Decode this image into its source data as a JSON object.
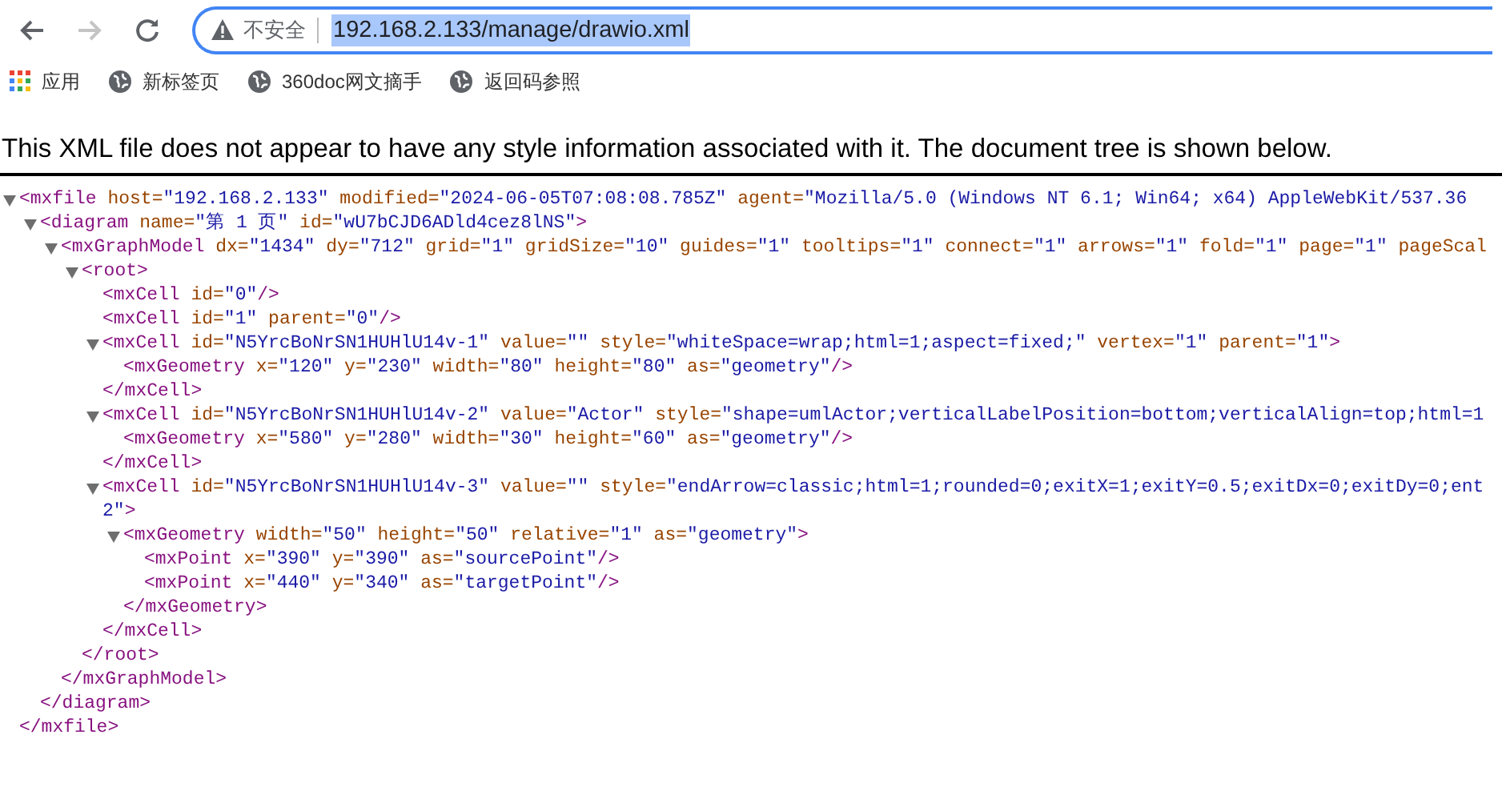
{
  "toolbar": {
    "back_disabled": false,
    "forward_disabled": true,
    "security_label": "不安全",
    "url": {
      "text": "192.168.2.133/manage/drawio.xml",
      "selected": true
    }
  },
  "bookmarks": [
    {
      "kind": "apps",
      "label": "应用"
    },
    {
      "kind": "page",
      "label": "新标签页"
    },
    {
      "kind": "page",
      "label": "360doc网文摘手"
    },
    {
      "kind": "page",
      "label": "返回码参照"
    }
  ],
  "notice": "This XML file does not appear to have any style information associated with it. The document tree is shown below.",
  "tree": [
    {
      "expanded": true,
      "line": [
        {
          "kind": "tag",
          "text": "<mxfile"
        },
        {
          "kind": "attr",
          "text": " host="
        },
        {
          "kind": "value",
          "text": "\"192.168.2.133\""
        },
        {
          "kind": "attr",
          "text": " modified="
        },
        {
          "kind": "value",
          "text": "\"2024-06-05T07:08:08.785Z\""
        },
        {
          "kind": "attr",
          "text": " agent="
        },
        {
          "kind": "value",
          "text": "\"Mozilla/5.0 (Windows NT 6.1; Win64; x64) AppleWebKit/537.36"
        }
      ],
      "children": [
        {
          "expanded": true,
          "line": [
            {
              "kind": "tag",
              "text": "<diagram"
            },
            {
              "kind": "attr",
              "text": " name="
            },
            {
              "kind": "value",
              "text": "\"第 1 页\""
            },
            {
              "kind": "attr",
              "text": " id="
            },
            {
              "kind": "value",
              "text": "\"wU7bCJD6ADld4cez8lNS\""
            },
            {
              "kind": "tag",
              "text": ">"
            }
          ],
          "children": [
            {
              "expanded": true,
              "line": [
                {
                  "kind": "tag",
                  "text": "<mxGraphModel"
                },
                {
                  "kind": "attr",
                  "text": " dx="
                },
                {
                  "kind": "value",
                  "text": "\"1434\""
                },
                {
                  "kind": "attr",
                  "text": " dy="
                },
                {
                  "kind": "value",
                  "text": "\"712\""
                },
                {
                  "kind": "attr",
                  "text": " grid="
                },
                {
                  "kind": "value",
                  "text": "\"1\""
                },
                {
                  "kind": "attr",
                  "text": " gridSize="
                },
                {
                  "kind": "value",
                  "text": "\"10\""
                },
                {
                  "kind": "attr",
                  "text": " guides="
                },
                {
                  "kind": "value",
                  "text": "\"1\""
                },
                {
                  "kind": "attr",
                  "text": " tooltips="
                },
                {
                  "kind": "value",
                  "text": "\"1\""
                },
                {
                  "kind": "attr",
                  "text": " connect="
                },
                {
                  "kind": "value",
                  "text": "\"1\""
                },
                {
                  "kind": "attr",
                  "text": " arrows="
                },
                {
                  "kind": "value",
                  "text": "\"1\""
                },
                {
                  "kind": "attr",
                  "text": " fold="
                },
                {
                  "kind": "value",
                  "text": "\"1\""
                },
                {
                  "kind": "attr",
                  "text": " page="
                },
                {
                  "kind": "value",
                  "text": "\"1\""
                },
                {
                  "kind": "attr",
                  "text": " pageScal"
                }
              ],
              "children": [
                {
                  "expanded": true,
                  "line": [
                    {
                      "kind": "tag",
                      "text": "<root>"
                    }
                  ],
                  "children": [
                    {
                      "line": [
                        {
                          "kind": "tag",
                          "text": "<mxCell"
                        },
                        {
                          "kind": "attr",
                          "text": " id="
                        },
                        {
                          "kind": "value",
                          "text": "\"0\""
                        },
                        {
                          "kind": "tag",
                          "text": "/>"
                        }
                      ]
                    },
                    {
                      "line": [
                        {
                          "kind": "tag",
                          "text": "<mxCell"
                        },
                        {
                          "kind": "attr",
                          "text": " id="
                        },
                        {
                          "kind": "value",
                          "text": "\"1\""
                        },
                        {
                          "kind": "attr",
                          "text": " parent="
                        },
                        {
                          "kind": "value",
                          "text": "\"0\""
                        },
                        {
                          "kind": "tag",
                          "text": "/>"
                        }
                      ]
                    },
                    {
                      "expanded": true,
                      "line": [
                        {
                          "kind": "tag",
                          "text": "<mxCell"
                        },
                        {
                          "kind": "attr",
                          "text": " id="
                        },
                        {
                          "kind": "value",
                          "text": "\"N5YrcBoNrSN1HUHlU14v-1\""
                        },
                        {
                          "kind": "attr",
                          "text": " value="
                        },
                        {
                          "kind": "value",
                          "text": "\"\""
                        },
                        {
                          "kind": "attr",
                          "text": " style="
                        },
                        {
                          "kind": "value",
                          "text": "\"whiteSpace=wrap;html=1;aspect=fixed;\""
                        },
                        {
                          "kind": "attr",
                          "text": " vertex="
                        },
                        {
                          "kind": "value",
                          "text": "\"1\""
                        },
                        {
                          "kind": "attr",
                          "text": " parent="
                        },
                        {
                          "kind": "value",
                          "text": "\"1\""
                        },
                        {
                          "kind": "tag",
                          "text": ">"
                        }
                      ],
                      "children": [
                        {
                          "line": [
                            {
                              "kind": "tag",
                              "text": "<mxGeometry"
                            },
                            {
                              "kind": "attr",
                              "text": " x="
                            },
                            {
                              "kind": "value",
                              "text": "\"120\""
                            },
                            {
                              "kind": "attr",
                              "text": " y="
                            },
                            {
                              "kind": "value",
                              "text": "\"230\""
                            },
                            {
                              "kind": "attr",
                              "text": " width="
                            },
                            {
                              "kind": "value",
                              "text": "\"80\""
                            },
                            {
                              "kind": "attr",
                              "text": " height="
                            },
                            {
                              "kind": "value",
                              "text": "\"80\""
                            },
                            {
                              "kind": "attr",
                              "text": " as="
                            },
                            {
                              "kind": "value",
                              "text": "\"geometry\""
                            },
                            {
                              "kind": "tag",
                              "text": "/>"
                            }
                          ]
                        }
                      ],
                      "end": [
                        {
                          "kind": "tag",
                          "text": "</mxCell>"
                        }
                      ]
                    },
                    {
                      "expanded": true,
                      "line": [
                        {
                          "kind": "tag",
                          "text": "<mxCell"
                        },
                        {
                          "kind": "attr",
                          "text": " id="
                        },
                        {
                          "kind": "value",
                          "text": "\"N5YrcBoNrSN1HUHlU14v-2\""
                        },
                        {
                          "kind": "attr",
                          "text": " value="
                        },
                        {
                          "kind": "value",
                          "text": "\"Actor\""
                        },
                        {
                          "kind": "attr",
                          "text": " style="
                        },
                        {
                          "kind": "value",
                          "text": "\"shape=umlActor;verticalLabelPosition=bottom;verticalAlign=top;html=1"
                        }
                      ],
                      "children": [
                        {
                          "line": [
                            {
                              "kind": "tag",
                              "text": "<mxGeometry"
                            },
                            {
                              "kind": "attr",
                              "text": " x="
                            },
                            {
                              "kind": "value",
                              "text": "\"580\""
                            },
                            {
                              "kind": "attr",
                              "text": " y="
                            },
                            {
                              "kind": "value",
                              "text": "\"280\""
                            },
                            {
                              "kind": "attr",
                              "text": " width="
                            },
                            {
                              "kind": "value",
                              "text": "\"30\""
                            },
                            {
                              "kind": "attr",
                              "text": " height="
                            },
                            {
                              "kind": "value",
                              "text": "\"60\""
                            },
                            {
                              "kind": "attr",
                              "text": " as="
                            },
                            {
                              "kind": "value",
                              "text": "\"geometry\""
                            },
                            {
                              "kind": "tag",
                              "text": "/>"
                            }
                          ]
                        }
                      ],
                      "end": [
                        {
                          "kind": "tag",
                          "text": "</mxCell>"
                        }
                      ]
                    },
                    {
                      "expanded": true,
                      "line": [
                        {
                          "kind": "tag",
                          "text": "<mxCell"
                        },
                        {
                          "kind": "attr",
                          "text": " id="
                        },
                        {
                          "kind": "value",
                          "text": "\"N5YrcBoNrSN1HUHlU14v-3\""
                        },
                        {
                          "kind": "attr",
                          "text": " value="
                        },
                        {
                          "kind": "value",
                          "text": "\"\""
                        },
                        {
                          "kind": "attr",
                          "text": " style="
                        },
                        {
                          "kind": "value",
                          "text": "\"endArrow=classic;html=1;rounded=0;exitX=1;exitY=0.5;exitDx=0;exitDy=0;ent"
                        }
                      ],
                      "line_continued": [
                        {
                          "kind": "value",
                          "text": "2\""
                        },
                        {
                          "kind": "tag",
                          "text": ">"
                        }
                      ],
                      "children": [
                        {
                          "expanded": true,
                          "line": [
                            {
                              "kind": "tag",
                              "text": "<mxGeometry"
                            },
                            {
                              "kind": "attr",
                              "text": " width="
                            },
                            {
                              "kind": "value",
                              "text": "\"50\""
                            },
                            {
                              "kind": "attr",
                              "text": " height="
                            },
                            {
                              "kind": "value",
                              "text": "\"50\""
                            },
                            {
                              "kind": "attr",
                              "text": " relative="
                            },
                            {
                              "kind": "value",
                              "text": "\"1\""
                            },
                            {
                              "kind": "attr",
                              "text": " as="
                            },
                            {
                              "kind": "value",
                              "text": "\"geometry\""
                            },
                            {
                              "kind": "tag",
                              "text": ">"
                            }
                          ],
                          "children": [
                            {
                              "line": [
                                {
                                  "kind": "tag",
                                  "text": "<mxPoint"
                                },
                                {
                                  "kind": "attr",
                                  "text": " x="
                                },
                                {
                                  "kind": "value",
                                  "text": "\"390\""
                                },
                                {
                                  "kind": "attr",
                                  "text": " y="
                                },
                                {
                                  "kind": "value",
                                  "text": "\"390\""
                                },
                                {
                                  "kind": "attr",
                                  "text": " as="
                                },
                                {
                                  "kind": "value",
                                  "text": "\"sourcePoint\""
                                },
                                {
                                  "kind": "tag",
                                  "text": "/>"
                                }
                              ]
                            },
                            {
                              "line": [
                                {
                                  "kind": "tag",
                                  "text": "<mxPoint"
                                },
                                {
                                  "kind": "attr",
                                  "text": " x="
                                },
                                {
                                  "kind": "value",
                                  "text": "\"440\""
                                },
                                {
                                  "kind": "attr",
                                  "text": " y="
                                },
                                {
                                  "kind": "value",
                                  "text": "\"340\""
                                },
                                {
                                  "kind": "attr",
                                  "text": " as="
                                },
                                {
                                  "kind": "value",
                                  "text": "\"targetPoint\""
                                },
                                {
                                  "kind": "tag",
                                  "text": "/>"
                                }
                              ]
                            }
                          ],
                          "end": [
                            {
                              "kind": "tag",
                              "text": "</mxGeometry>"
                            }
                          ]
                        }
                      ],
                      "end": [
                        {
                          "kind": "tag",
                          "text": "</mxCell>"
                        }
                      ]
                    }
                  ],
                  "end": [
                    {
                      "kind": "tag",
                      "text": "</root>"
                    }
                  ]
                }
              ],
              "end": [
                {
                  "kind": "tag",
                  "text": "</mxGraphModel>"
                }
              ]
            }
          ],
          "end": [
            {
              "kind": "tag",
              "text": "</diagram>"
            }
          ]
        }
      ],
      "end": [
        {
          "kind": "tag",
          "text": "</mxfile>"
        }
      ]
    }
  ]
}
